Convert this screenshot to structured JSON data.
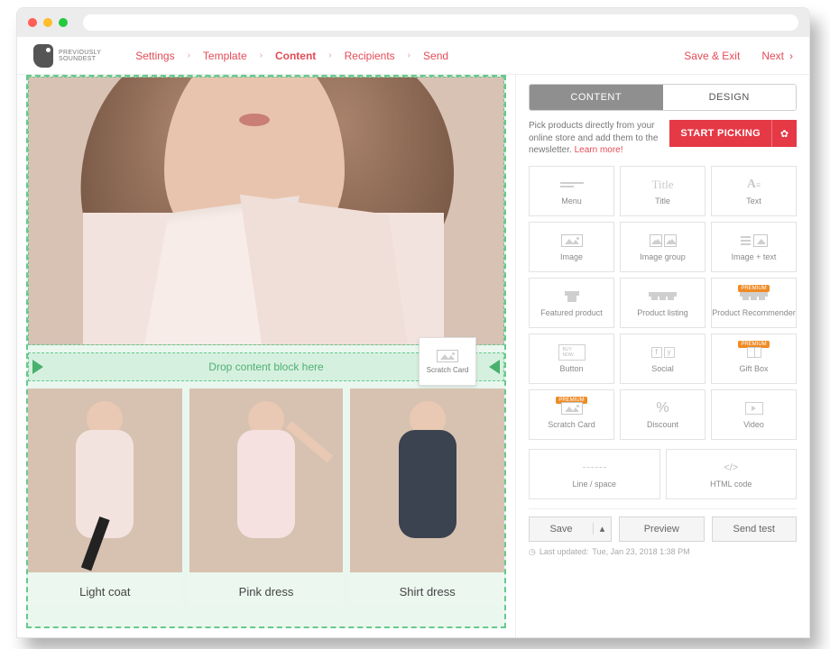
{
  "logo": {
    "line1": "PREVIOUSLY",
    "line2": "SOUNDEST"
  },
  "crumbs": [
    "Settings",
    "Template",
    "Content",
    "Recipients",
    "Send"
  ],
  "crumbs_active_index": 2,
  "header_actions": {
    "save_exit": "Save & Exit",
    "next": "Next"
  },
  "dropzone": {
    "label": "Drop content block here"
  },
  "drag_card": {
    "label": "Scratch Card"
  },
  "products": [
    {
      "label": "Light coat"
    },
    {
      "label": "Pink dress"
    },
    {
      "label": "Shirt dress"
    }
  ],
  "sidebar": {
    "tabs": {
      "content": "CONTENT",
      "design": "DESIGN",
      "active": "content"
    },
    "pick_desc": "Pick products directly from your online store and add them to the newsletter.",
    "pick_learn": "Learn more!",
    "pick_button": "START PICKING",
    "blocks": [
      {
        "id": "menu",
        "label": "Menu",
        "premium": false
      },
      {
        "id": "title",
        "label": "Title",
        "premium": false
      },
      {
        "id": "text",
        "label": "Text",
        "premium": false
      },
      {
        "id": "image",
        "label": "Image",
        "premium": false
      },
      {
        "id": "image-group",
        "label": "Image group",
        "premium": false
      },
      {
        "id": "image-text",
        "label": "Image + text",
        "premium": false
      },
      {
        "id": "featured-product",
        "label": "Featured product",
        "premium": false
      },
      {
        "id": "product-listing",
        "label": "Product listing",
        "premium": false
      },
      {
        "id": "product-recommender",
        "label": "Product Recommender",
        "premium": true
      },
      {
        "id": "button",
        "label": "Button",
        "premium": false
      },
      {
        "id": "social",
        "label": "Social",
        "premium": false
      },
      {
        "id": "gift-box",
        "label": "Gift Box",
        "premium": true
      },
      {
        "id": "scratch-card",
        "label": "Scratch Card",
        "premium": true
      },
      {
        "id": "discount",
        "label": "Discount",
        "premium": false
      },
      {
        "id": "video",
        "label": "Video",
        "premium": false
      },
      {
        "id": "line-space",
        "label": "Line / space",
        "premium": false
      },
      {
        "id": "html-code",
        "label": "HTML code",
        "premium": false
      }
    ]
  },
  "footer": {
    "save": "Save",
    "preview": "Preview",
    "send_test": "Send test",
    "last_updated_label": "Last updated:",
    "last_updated_value": "Tue, Jan 23, 2018 1:38 PM"
  },
  "premium_badge": "PREMIUM",
  "icons": {
    "button_small": "BUY NOW"
  }
}
